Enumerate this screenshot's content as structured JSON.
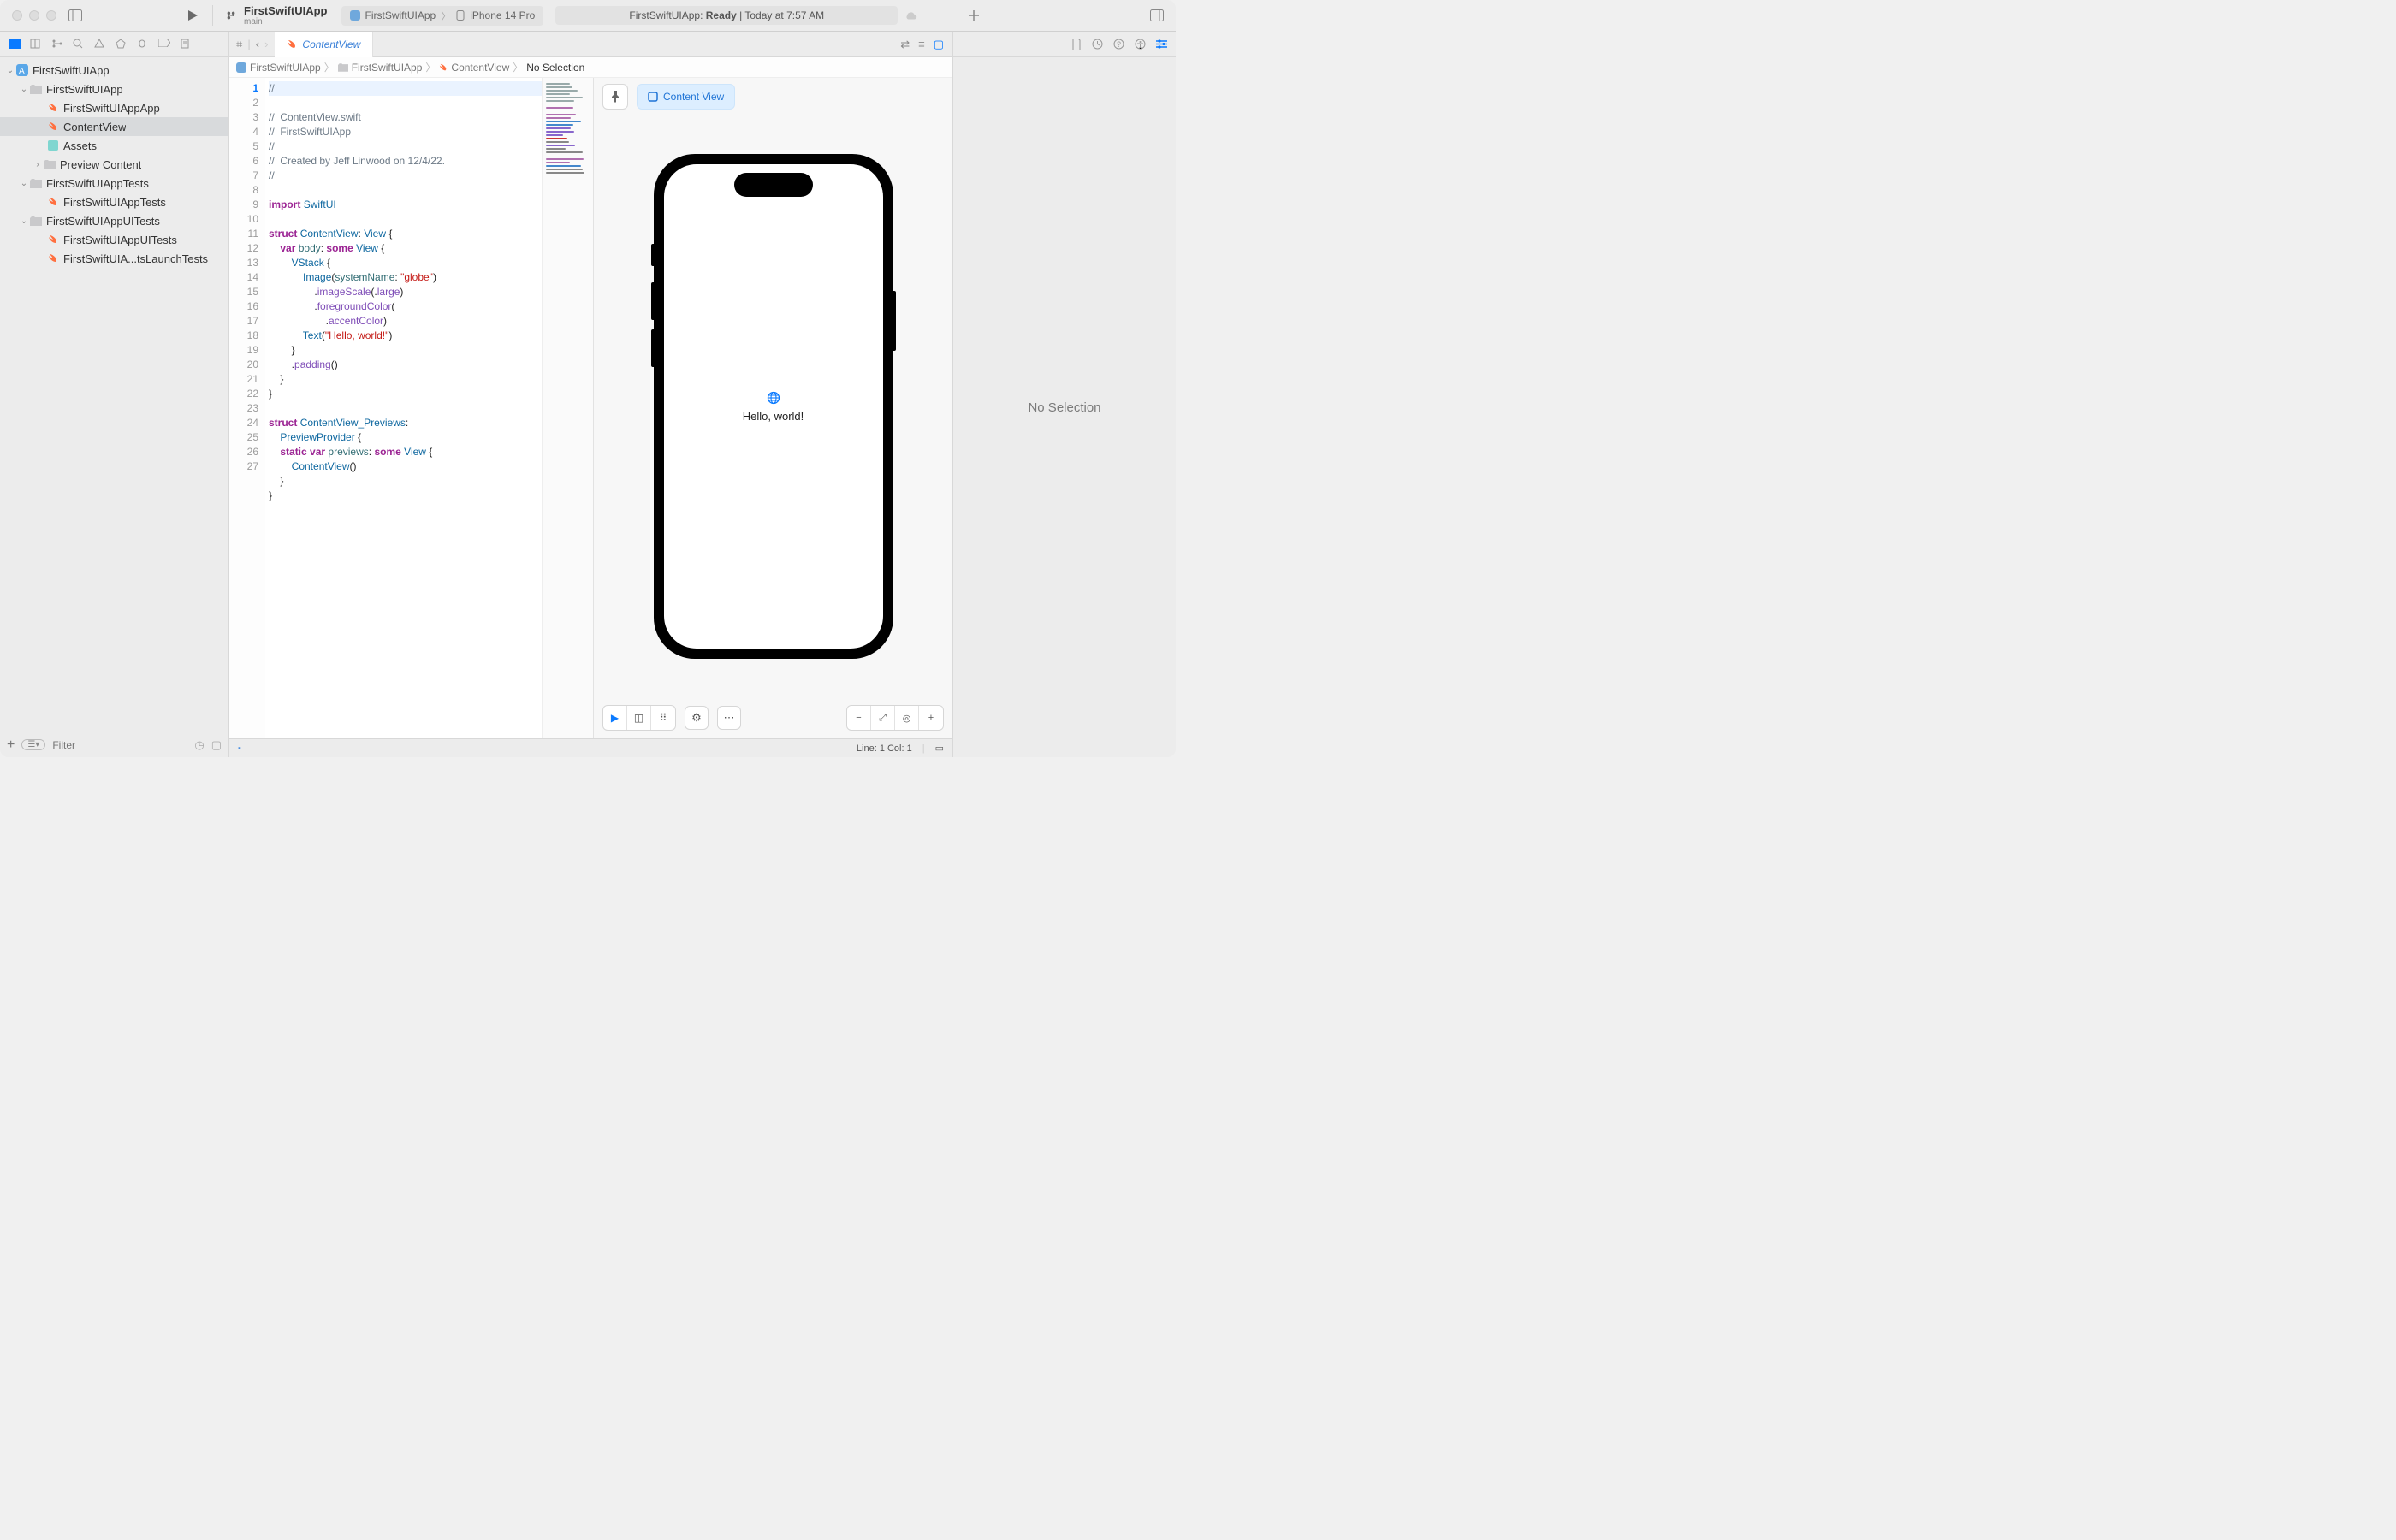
{
  "toolbar": {
    "project": "FirstSwiftUIApp",
    "branch": "main",
    "scheme_app": "FirstSwiftUIApp",
    "scheme_dest": "iPhone 14 Pro",
    "status_app": "FirstSwiftUIApp:",
    "status_ready": "Ready",
    "status_time": "Today at 7:57 AM"
  },
  "navigator": {
    "filter_placeholder": "Filter",
    "tree": {
      "root": "FirstSwiftUIApp",
      "group1": "FirstSwiftUIApp",
      "file_app": "FirstSwiftUIAppApp",
      "file_cv": "ContentView",
      "file_assets": "Assets",
      "folder_preview": "Preview Content",
      "group_tests": "FirstSwiftUIAppTests",
      "file_tests": "FirstSwiftUIAppTests",
      "group_ui": "FirstSwiftUIAppUITests",
      "file_ui1": "FirstSwiftUIAppUITests",
      "file_ui2": "FirstSwiftUIA...tsLaunchTests"
    }
  },
  "tabs": {
    "active": "ContentView"
  },
  "breadcrumb": {
    "p1": "FirstSwiftUIApp",
    "p2": "FirstSwiftUIApp",
    "p3": "ContentView",
    "p4": "No Selection"
  },
  "code": {
    "lines": [
      "//",
      "//  ContentView.swift",
      "//  FirstSwiftUIApp",
      "//",
      "//  Created by Jeff Linwood on 12/4/22.",
      "//",
      "",
      "import SwiftUI",
      "",
      "struct ContentView: View {",
      "    var body: some View {",
      "        VStack {",
      "            Image(systemName: \"globe\")",
      "                .imageScale(.large)",
      "                .foregroundColor(",
      "                    .accentColor)",
      "            Text(\"Hello, world!\")",
      "        }",
      "        .padding()",
      "    }",
      "}",
      "",
      "struct ContentView_Previews:",
      "    PreviewProvider {",
      "    static var previews: some View {",
      "        ContentView()",
      "    }",
      "}",
      ""
    ]
  },
  "canvas": {
    "pill_label": "Content View",
    "hello": "Hello, world!"
  },
  "inspector": {
    "no_selection": "No Selection"
  },
  "statusbar": {
    "cursor": "Line: 1  Col: 1"
  }
}
